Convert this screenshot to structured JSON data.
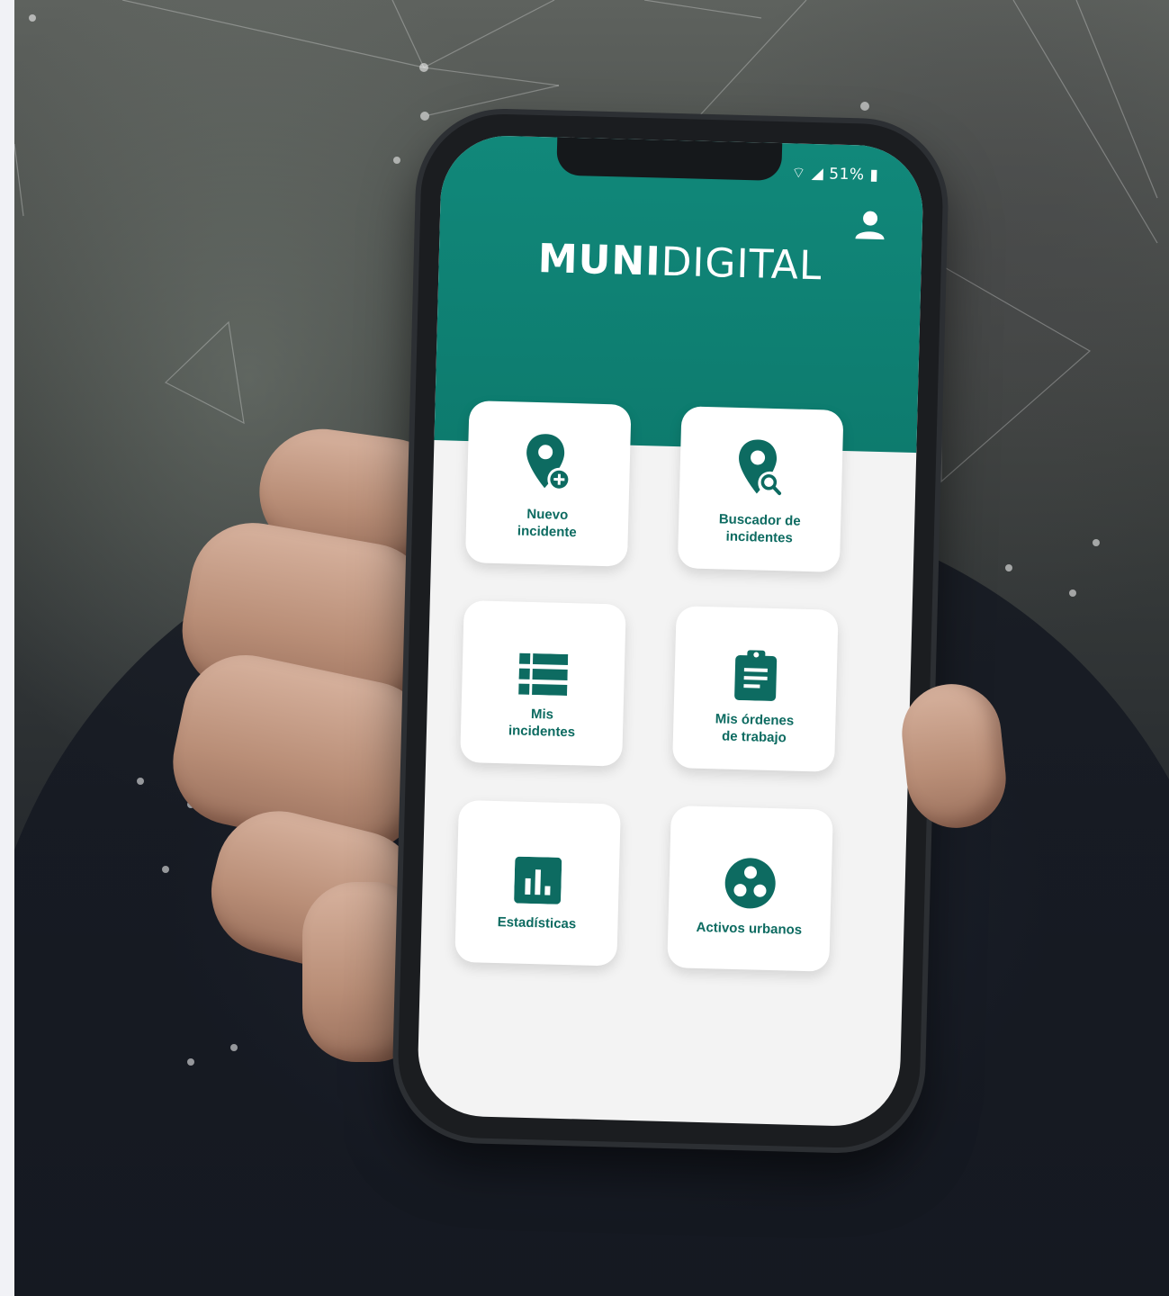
{
  "status_bar": {
    "battery": "51%"
  },
  "app": {
    "brand_bold": "MUNI",
    "brand_light": "DIGITAL"
  },
  "tiles": [
    {
      "label": "Nuevo\nincidente",
      "icon": "map-pin-plus-icon"
    },
    {
      "label": "Buscador de\nincidentes",
      "icon": "map-pin-search-icon"
    },
    {
      "label": "Mis\nincidentes",
      "icon": "list-icon"
    },
    {
      "label": "Mis órdenes\nde trabajo",
      "icon": "clipboard-icon"
    },
    {
      "label": "Estadísticas",
      "icon": "bar-chart-icon"
    },
    {
      "label": "Activos urbanos",
      "icon": "assets-circle-icon"
    }
  ],
  "colors": {
    "primary": "#0d7b6e",
    "tile_text": "#0d6b61",
    "background": "#f3f3f3"
  }
}
